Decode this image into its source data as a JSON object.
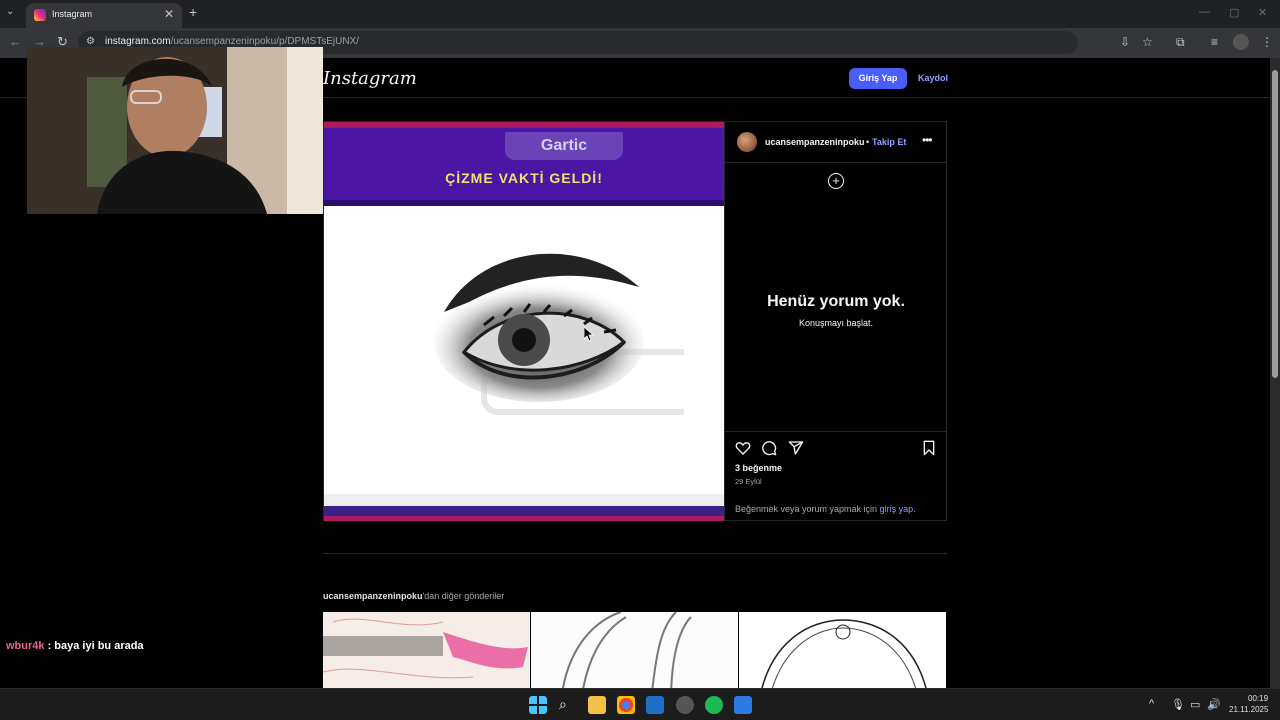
{
  "browser": {
    "tab_title": "Instagram",
    "tab_close": "✕",
    "new_tab": "+",
    "tab_list": "⌄",
    "url_host": "instagram.com",
    "url_path": "/ucansempanzeninpoku/p/DPMSTsEjUNX/",
    "back": "←",
    "forward": "→",
    "reload": "↻",
    "minimize": "—",
    "maximize": "▢",
    "close": "✕"
  },
  "instagram": {
    "logo": "Instagram",
    "login_button": "Giriş Yap",
    "signup_link": "Kaydol",
    "post": {
      "media_badge": "Gartic",
      "media_title": "ÇİZME VAKTİ GELDİ!",
      "author": "ucansempanzeninpoku",
      "separator": "•",
      "follow": "Takip Et",
      "more": "•••",
      "add_comment": "+",
      "no_comments_title": "Henüz yorum yok.",
      "no_comments_sub": "Konuşmayı başlat.",
      "likes": "3 beğenme",
      "date": "29 Eylül",
      "login_prompt_prefix": "Beğenmek veya yorum yapmak için ",
      "login_prompt_link": "giriş yap",
      "login_prompt_suffix": "."
    },
    "more_posts": {
      "author": "ucansempanzeninpoku",
      "suffix": "'dan diğer gönderiler"
    }
  },
  "chat": {
    "user": "wbur4k",
    "message": " : baya iyi bu arada"
  },
  "taskbar": {
    "time": "00:19",
    "date": "21.11.2025",
    "tray_up": "^"
  }
}
